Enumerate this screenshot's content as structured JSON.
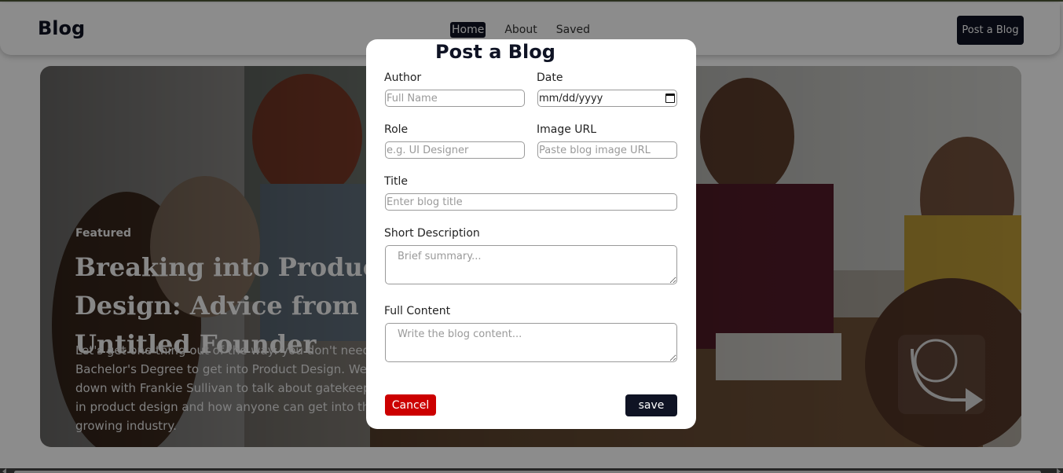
{
  "navbar": {
    "brand": "Blog",
    "links": [
      {
        "label": "Home",
        "active": true
      },
      {
        "label": "About",
        "active": false
      },
      {
        "label": "Saved",
        "active": false
      }
    ],
    "cta_label": "Post a Blog"
  },
  "hero": {
    "tag": "Featured",
    "title": "Breaking into Product Design: Advice from Untitled Founder",
    "description": "Let's get one thing out of the way: you don't need a Bachelor's Degree to get into Product Design. We sat down with Frankie Sullivan to talk about gatekeeping in product design and how anyone can get into this growing industry."
  },
  "modal": {
    "title": "Post a Blog",
    "author": {
      "label": "Author",
      "placeholder": "Full Name"
    },
    "date": {
      "label": "Date",
      "value": "mm/dd/yyyy"
    },
    "role": {
      "label": "Role",
      "placeholder": "e.g. UI Designer"
    },
    "image_url": {
      "label": "Image URL",
      "placeholder": "Paste blog image URL"
    },
    "title_field": {
      "label": "Title",
      "placeholder": "Enter blog title"
    },
    "short_description": {
      "label": "Short Description",
      "placeholder": "Brief summary..."
    },
    "full_content": {
      "label": "Full Content",
      "placeholder": "Write the blog content..."
    },
    "cancel_label": "Cancel",
    "save_label": "save"
  },
  "colors": {
    "primary_dark": "#0f1324",
    "cancel_red": "#cc0000",
    "backdrop": "rgba(0,0,0,0.45)"
  }
}
